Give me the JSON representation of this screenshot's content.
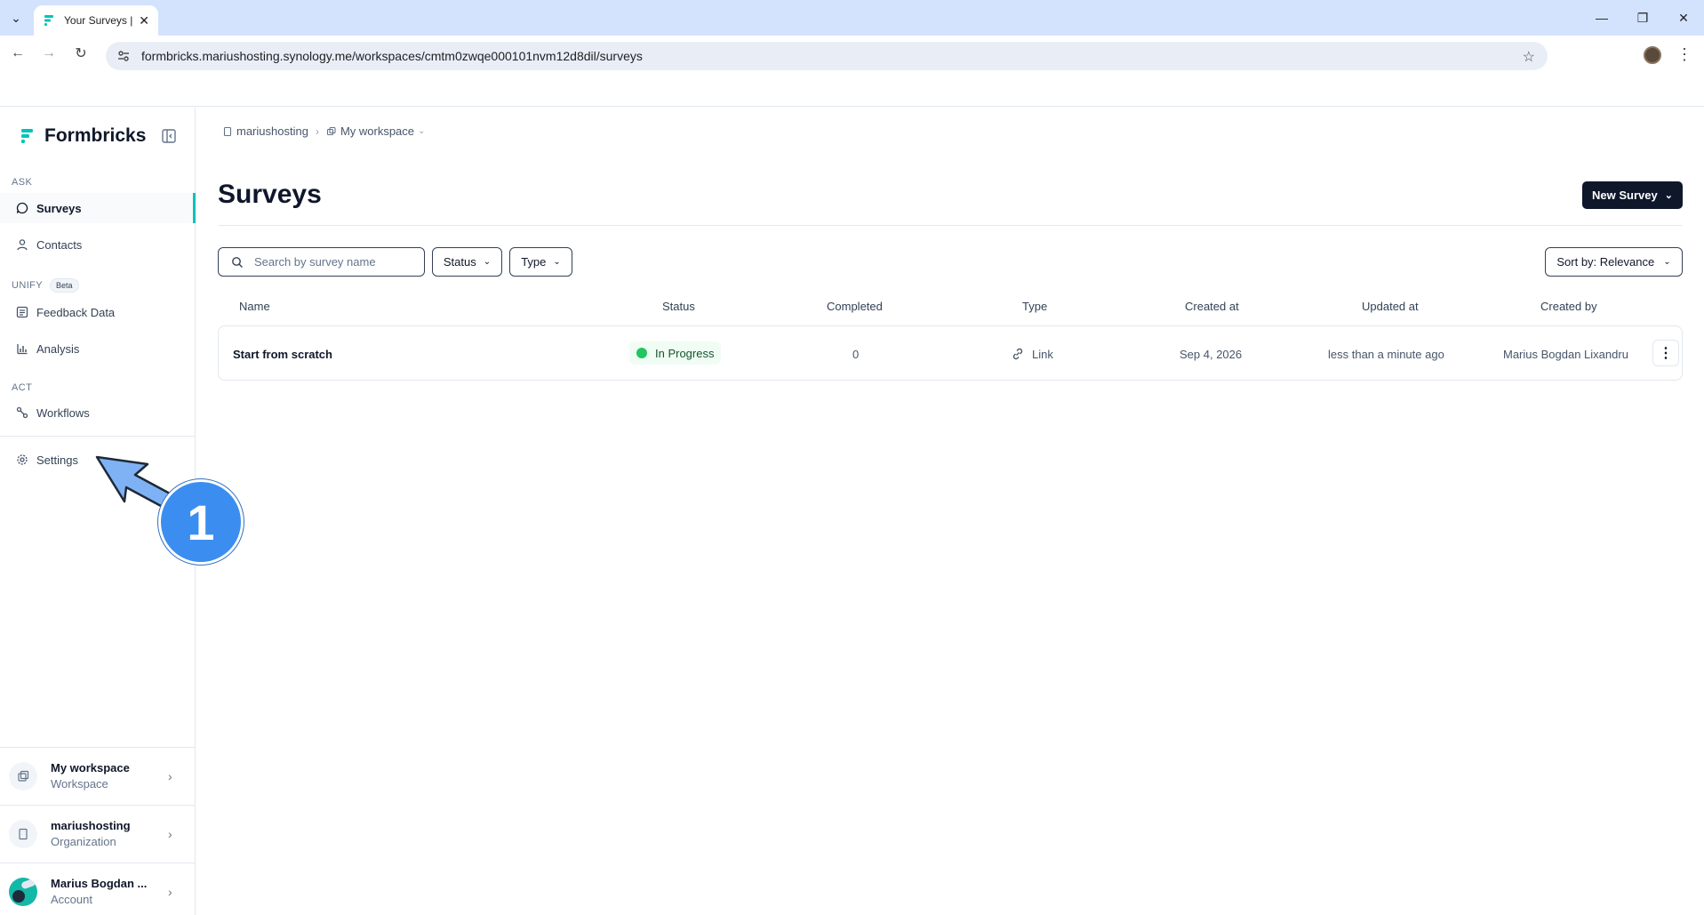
{
  "browser": {
    "tab_title": "Your Surveys | Formbricks",
    "url": "formbricks.mariushosting.synology.me/workspaces/cmtm0zwqe000101nvm12d8dil/surveys"
  },
  "sidebar": {
    "brand": "Formbricks",
    "sections": {
      "ask": "ASK",
      "unify": "UNIFY",
      "unify_badge": "Beta",
      "act": "ACT"
    },
    "items": {
      "surveys": "Surveys",
      "contacts": "Contacts",
      "feedback_data": "Feedback Data",
      "analysis": "Analysis",
      "workflows": "Workflows",
      "settings": "Settings"
    },
    "footer": {
      "workspace_title": "My workspace",
      "workspace_sub": "Workspace",
      "org_title": "mariushosting",
      "org_sub": "Organization",
      "account_title": "Marius Bogdan ...",
      "account_sub": "Account"
    }
  },
  "breadcrumb": {
    "org": "mariushosting",
    "workspace": "My workspace"
  },
  "main": {
    "title": "Surveys",
    "new_survey_label": "New Survey",
    "search_placeholder": "Search by survey name",
    "filter_status": "Status",
    "filter_type": "Type",
    "sort_label": "Sort by: Relevance",
    "columns": {
      "name": "Name",
      "status": "Status",
      "completed": "Completed",
      "type": "Type",
      "created_at": "Created at",
      "updated_at": "Updated at",
      "created_by": "Created by"
    },
    "rows": [
      {
        "name": "Start from scratch",
        "status": "In Progress",
        "completed": "0",
        "type": "Link",
        "created_at": "Sep 4, 2026",
        "updated_at": "less than a minute ago",
        "created_by": "Marius Bogdan Lixandru"
      }
    ]
  },
  "annotation": {
    "step_number": "1"
  },
  "colors": {
    "accent": "#00c4b8",
    "primary_button": "#0f172a",
    "status_green": "#22c55e",
    "annotation_blue": "#3b8ef0"
  }
}
